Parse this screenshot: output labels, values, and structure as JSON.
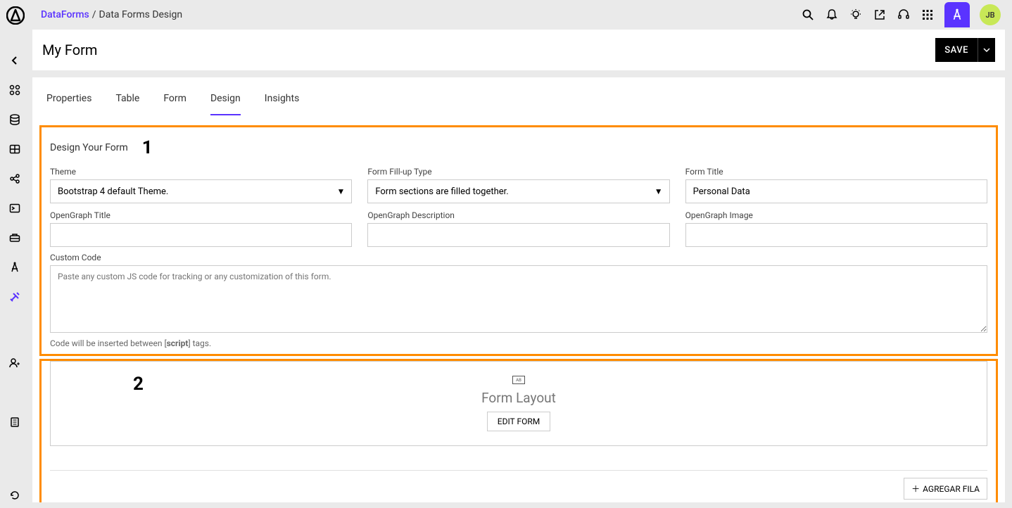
{
  "breadcrumb": {
    "parent": "DataForms",
    "separator": " / ",
    "current": "Data Forms Design"
  },
  "avatar": "JB",
  "page_title": "My Form",
  "save_label": "SAVE",
  "tabs": [
    "Properties",
    "Table",
    "Form",
    "Design",
    "Insights"
  ],
  "design_section": {
    "title": "Design Your Form",
    "callout": "1",
    "theme": {
      "label": "Theme",
      "value": "Bootstrap 4 default Theme."
    },
    "fillup": {
      "label": "Form Fill-up Type",
      "value": "Form sections are filled together."
    },
    "form_title": {
      "label": "Form Title",
      "value": "Personal Data"
    },
    "og_title": {
      "label": "OpenGraph Title",
      "value": ""
    },
    "og_desc": {
      "label": "OpenGraph Description",
      "value": ""
    },
    "og_image": {
      "label": "OpenGraph Image",
      "value": ""
    },
    "custom_code": {
      "label": "Custom Code",
      "placeholder": "Paste any custom JS code for tracking or any customization of this form.",
      "hint_pre": "Code will be inserted between [",
      "hint_bold": "script",
      "hint_post": "] tags."
    }
  },
  "layout_section": {
    "callout": "2",
    "heading": "Form Layout",
    "edit_label": "EDIT FORM",
    "add_row_label": "AGREGAR FILA"
  }
}
